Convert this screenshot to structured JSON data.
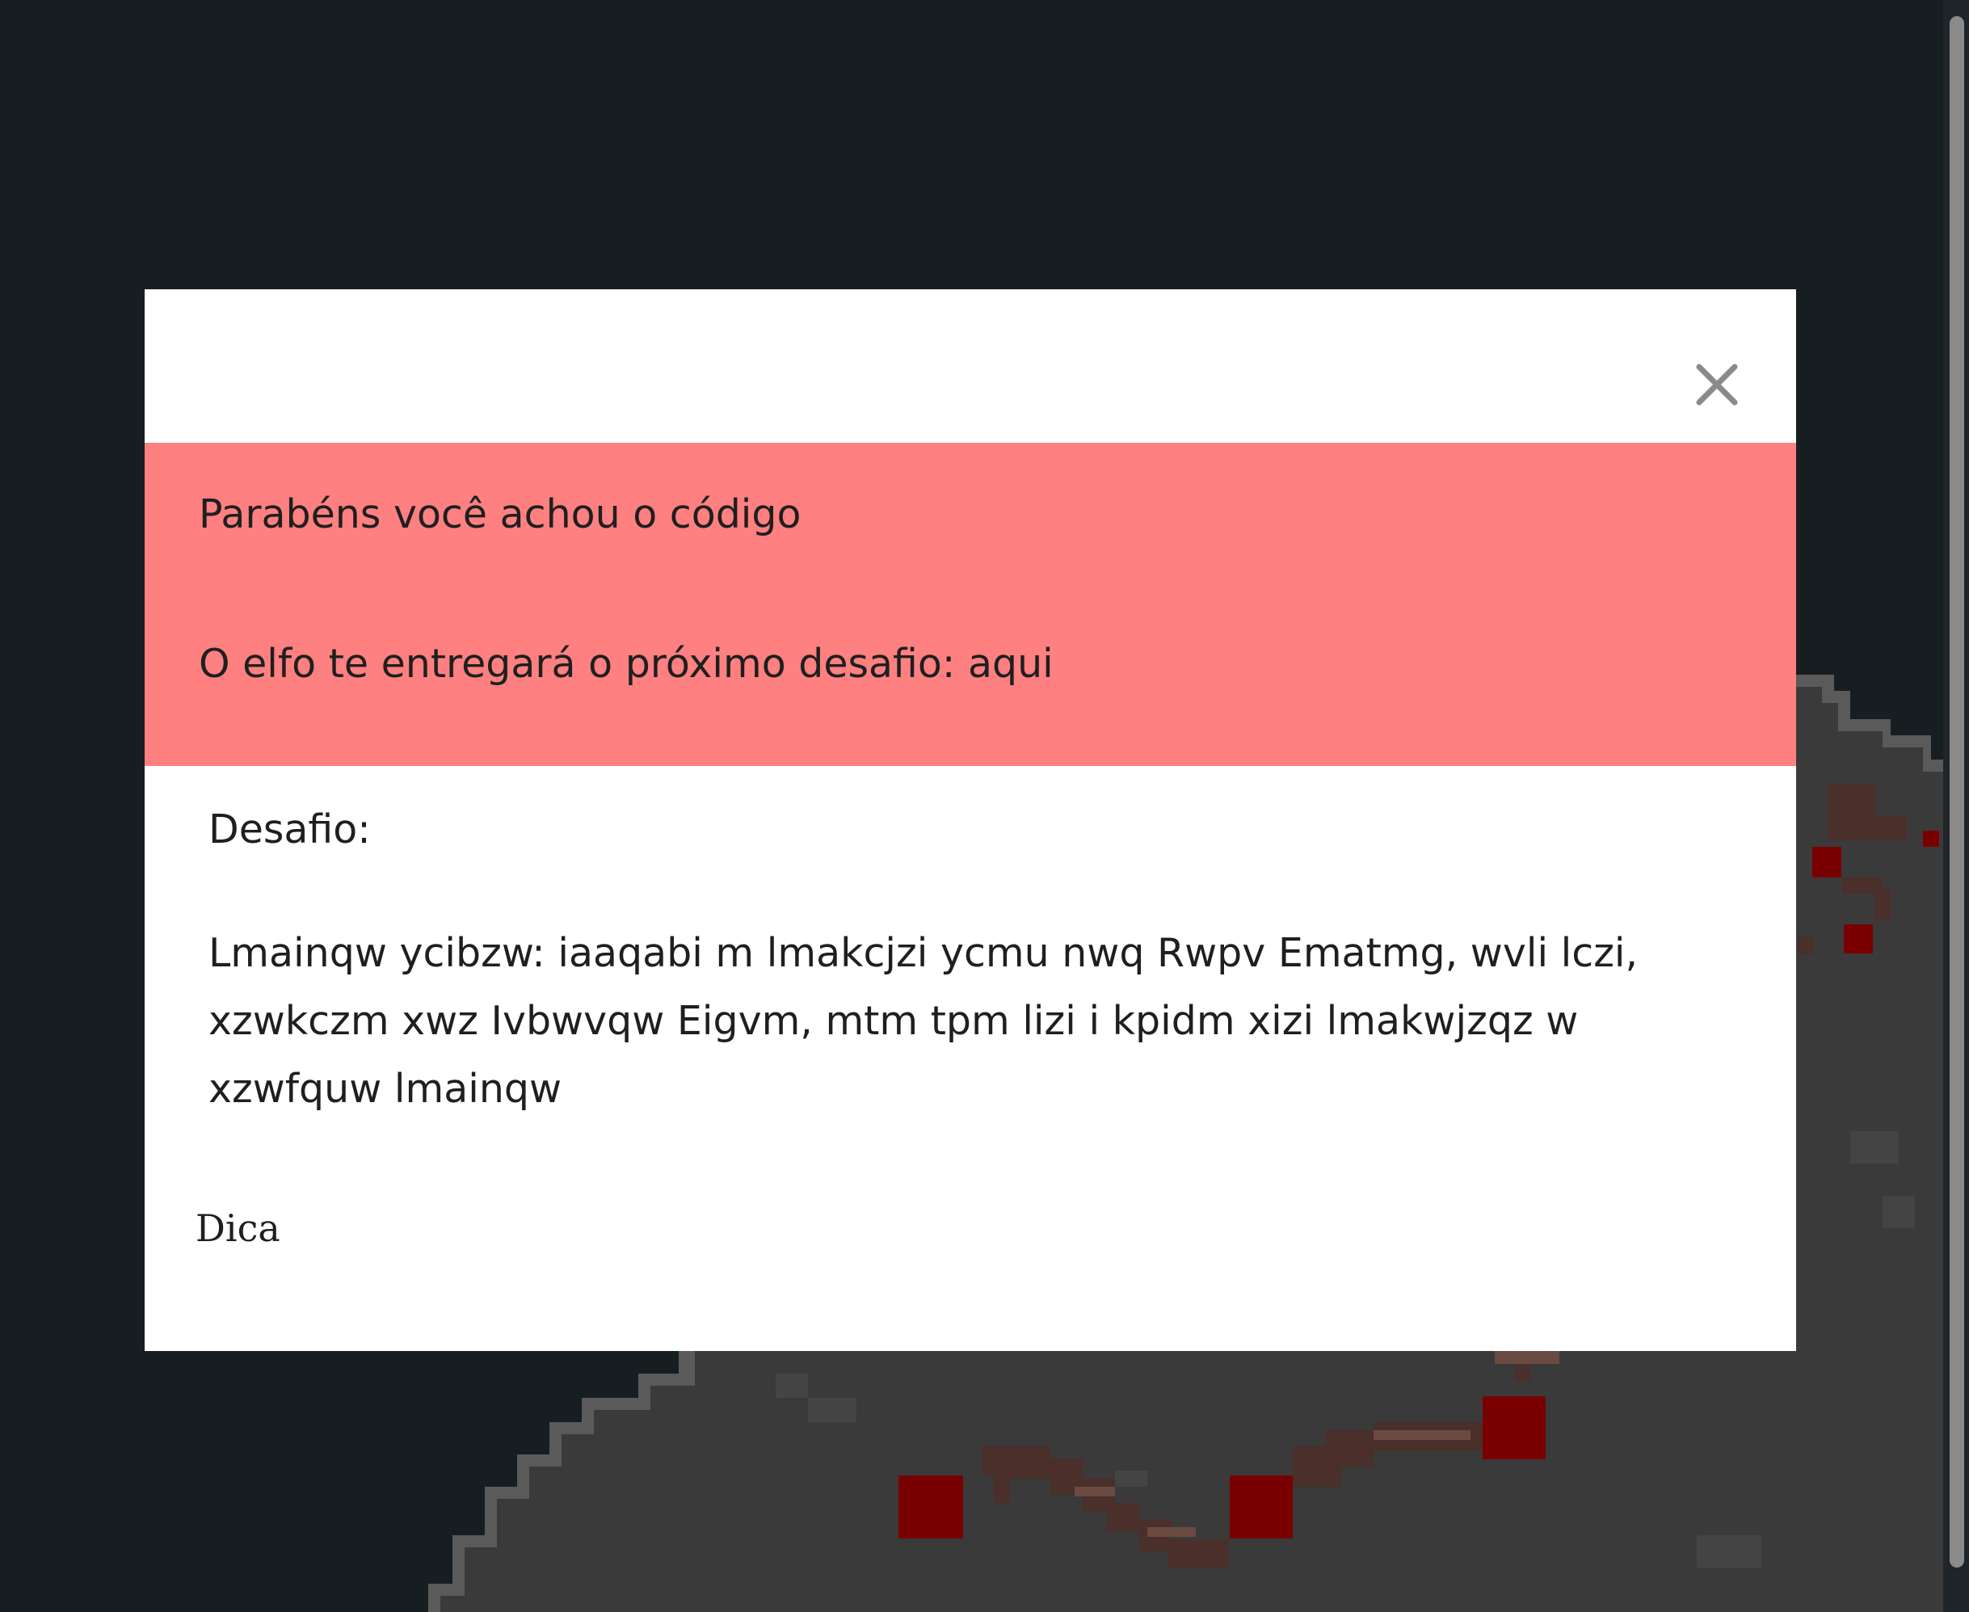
{
  "modal": {
    "close_icon": "close-icon",
    "alert": {
      "line1": "Parabéns você achou o código",
      "line2": "O elfo te entregará o próximo desafio: aqui",
      "background_color": "#ff8080"
    },
    "challenge": {
      "title": "Desafio:",
      "text": "Lmainqw ycibzw: iaaqabi m lmakcjzi ycmu nwq Rwpv Ematmg, wvli lczi, xzwkczm xwz Ivbwvqw Eigvm, mtm tpm lizi i kpidm xizi lmakwjzqz w xzwfquw lmainqw"
    },
    "hint_label": "Dica"
  },
  "colors": {
    "page_background": "#171e22",
    "rock": "#3a3a3a",
    "rock_edge": "#5a5a5a",
    "blood": "#7a0000",
    "wood": "#4a2f2a"
  }
}
